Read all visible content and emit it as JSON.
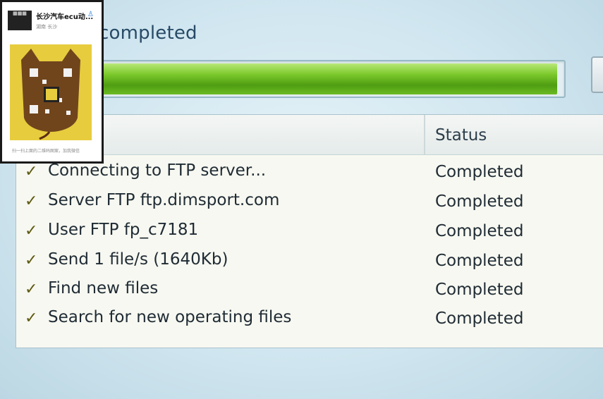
{
  "dialog": {
    "title": "completed",
    "progress_fraction": 0.99
  },
  "table": {
    "status_header": "Status",
    "rows": [
      {
        "check_icon": "✓",
        "task": "Connecting to FTP server...",
        "status": "Completed"
      },
      {
        "check_icon": "✓",
        "task": "Server FTP ftp.dimsport.com",
        "status": "Completed"
      },
      {
        "check_icon": "✓",
        "task": "User FTP fp_c7181",
        "status": "Completed"
      },
      {
        "check_icon": "✓",
        "task": "Send 1 file/s (1640Kb)",
        "status": "Completed"
      },
      {
        "check_icon": "✓",
        "task": "Find new files",
        "status": "Completed"
      },
      {
        "check_icon": "✓",
        "task": "Search for new operating files",
        "status": "Completed"
      }
    ]
  },
  "qr_overlay": {
    "name": "长沙汽车ecu动...",
    "region": "湖南 长沙",
    "caption": "扫一扫上面的二维码图案，加我微信",
    "person_icon": "person-icon"
  },
  "colors": {
    "progress_green": "#5fb51a",
    "qr_background": "#e7cc3e"
  }
}
